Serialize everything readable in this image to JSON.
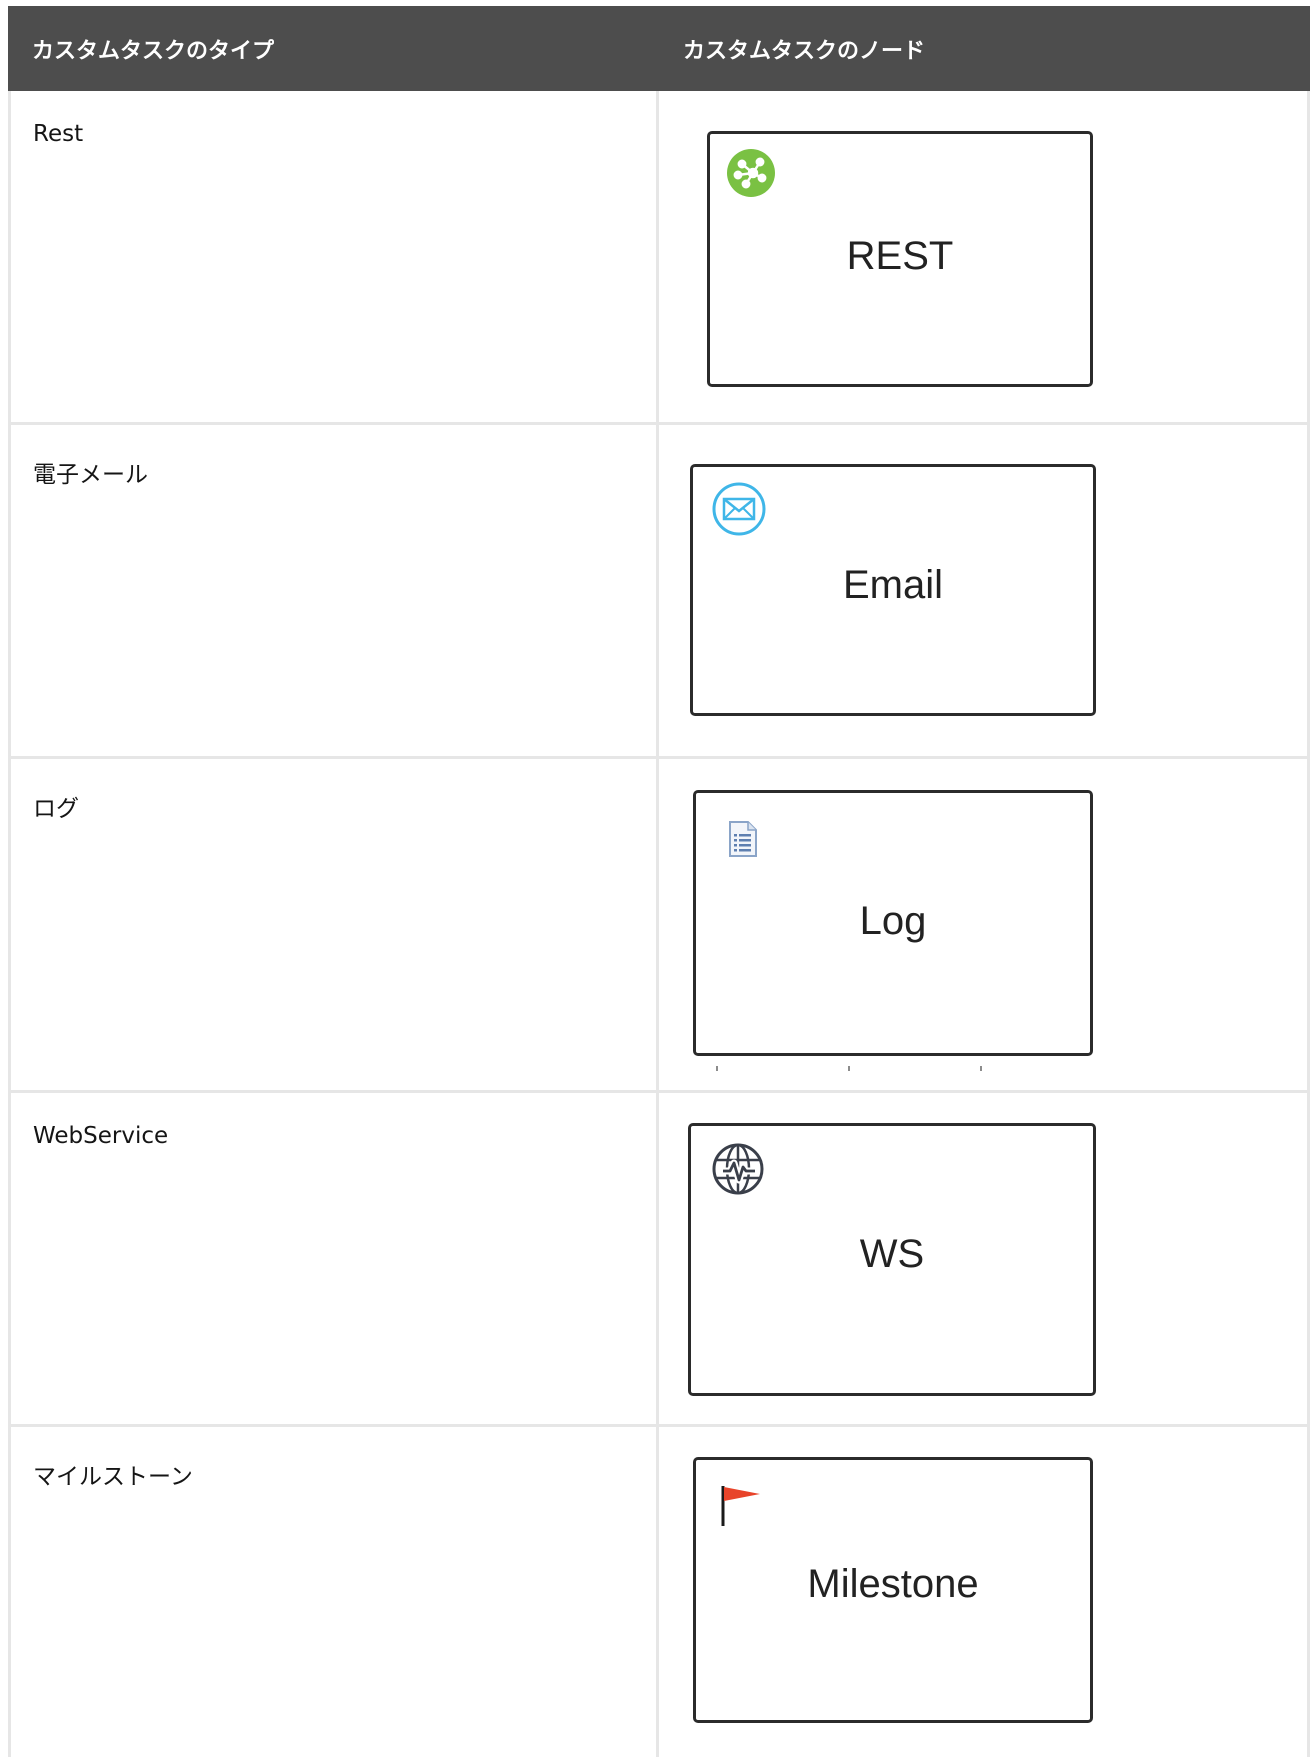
{
  "table": {
    "headers": [
      "カスタムタスクのタイプ",
      "カスタムタスクのノード"
    ],
    "rows": [
      {
        "type": "Rest",
        "node_label": "REST",
        "icon": "rest-network-icon",
        "icon_color": "#7ac143"
      },
      {
        "type": "電子メール",
        "node_label": "Email",
        "icon": "envelope-icon",
        "icon_color": "#3fb6e8"
      },
      {
        "type": "ログ",
        "node_label": "Log",
        "icon": "document-list-icon",
        "icon_color": "#8aa4c8"
      },
      {
        "type": "WebService",
        "node_label": "WS",
        "icon": "globe-pulse-icon",
        "icon_color": "#3a3f4a"
      },
      {
        "type": "マイルストーン",
        "node_label": "Milestone",
        "icon": "flag-icon",
        "icon_color": "#e8442a"
      }
    ]
  },
  "colors": {
    "header_bg": "#4d4d4d",
    "header_text": "#ffffff",
    "grid_line": "#e6e6e6",
    "node_border": "#2b2b2b"
  }
}
